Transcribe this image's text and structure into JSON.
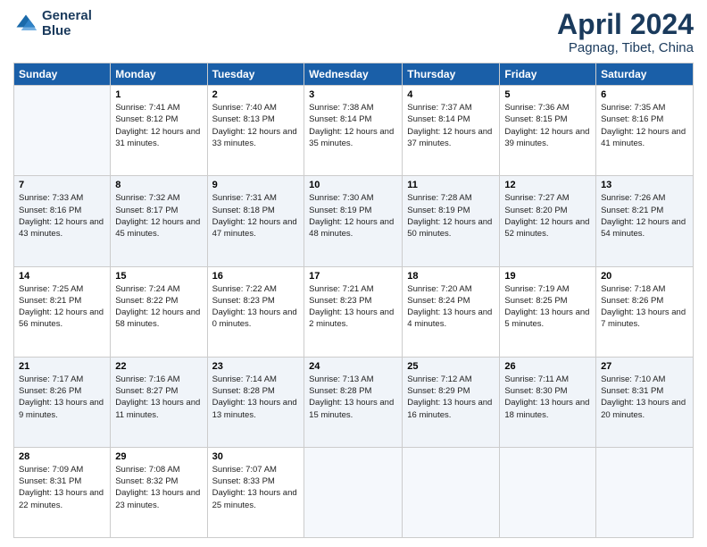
{
  "header": {
    "logo_line1": "General",
    "logo_line2": "Blue",
    "month": "April 2024",
    "location": "Pagnag, Tibet, China"
  },
  "days_of_week": [
    "Sunday",
    "Monday",
    "Tuesday",
    "Wednesday",
    "Thursday",
    "Friday",
    "Saturday"
  ],
  "weeks": [
    [
      {
        "day": "",
        "sunrise": "",
        "sunset": "",
        "daylight": ""
      },
      {
        "day": "1",
        "sunrise": "Sunrise: 7:41 AM",
        "sunset": "Sunset: 8:12 PM",
        "daylight": "Daylight: 12 hours and 31 minutes."
      },
      {
        "day": "2",
        "sunrise": "Sunrise: 7:40 AM",
        "sunset": "Sunset: 8:13 PM",
        "daylight": "Daylight: 12 hours and 33 minutes."
      },
      {
        "day": "3",
        "sunrise": "Sunrise: 7:38 AM",
        "sunset": "Sunset: 8:14 PM",
        "daylight": "Daylight: 12 hours and 35 minutes."
      },
      {
        "day": "4",
        "sunrise": "Sunrise: 7:37 AM",
        "sunset": "Sunset: 8:14 PM",
        "daylight": "Daylight: 12 hours and 37 minutes."
      },
      {
        "day": "5",
        "sunrise": "Sunrise: 7:36 AM",
        "sunset": "Sunset: 8:15 PM",
        "daylight": "Daylight: 12 hours and 39 minutes."
      },
      {
        "day": "6",
        "sunrise": "Sunrise: 7:35 AM",
        "sunset": "Sunset: 8:16 PM",
        "daylight": "Daylight: 12 hours and 41 minutes."
      }
    ],
    [
      {
        "day": "7",
        "sunrise": "Sunrise: 7:33 AM",
        "sunset": "Sunset: 8:16 PM",
        "daylight": "Daylight: 12 hours and 43 minutes."
      },
      {
        "day": "8",
        "sunrise": "Sunrise: 7:32 AM",
        "sunset": "Sunset: 8:17 PM",
        "daylight": "Daylight: 12 hours and 45 minutes."
      },
      {
        "day": "9",
        "sunrise": "Sunrise: 7:31 AM",
        "sunset": "Sunset: 8:18 PM",
        "daylight": "Daylight: 12 hours and 47 minutes."
      },
      {
        "day": "10",
        "sunrise": "Sunrise: 7:30 AM",
        "sunset": "Sunset: 8:19 PM",
        "daylight": "Daylight: 12 hours and 48 minutes."
      },
      {
        "day": "11",
        "sunrise": "Sunrise: 7:28 AM",
        "sunset": "Sunset: 8:19 PM",
        "daylight": "Daylight: 12 hours and 50 minutes."
      },
      {
        "day": "12",
        "sunrise": "Sunrise: 7:27 AM",
        "sunset": "Sunset: 8:20 PM",
        "daylight": "Daylight: 12 hours and 52 minutes."
      },
      {
        "day": "13",
        "sunrise": "Sunrise: 7:26 AM",
        "sunset": "Sunset: 8:21 PM",
        "daylight": "Daylight: 12 hours and 54 minutes."
      }
    ],
    [
      {
        "day": "14",
        "sunrise": "Sunrise: 7:25 AM",
        "sunset": "Sunset: 8:21 PM",
        "daylight": "Daylight: 12 hours and 56 minutes."
      },
      {
        "day": "15",
        "sunrise": "Sunrise: 7:24 AM",
        "sunset": "Sunset: 8:22 PM",
        "daylight": "Daylight: 12 hours and 58 minutes."
      },
      {
        "day": "16",
        "sunrise": "Sunrise: 7:22 AM",
        "sunset": "Sunset: 8:23 PM",
        "daylight": "Daylight: 13 hours and 0 minutes."
      },
      {
        "day": "17",
        "sunrise": "Sunrise: 7:21 AM",
        "sunset": "Sunset: 8:23 PM",
        "daylight": "Daylight: 13 hours and 2 minutes."
      },
      {
        "day": "18",
        "sunrise": "Sunrise: 7:20 AM",
        "sunset": "Sunset: 8:24 PM",
        "daylight": "Daylight: 13 hours and 4 minutes."
      },
      {
        "day": "19",
        "sunrise": "Sunrise: 7:19 AM",
        "sunset": "Sunset: 8:25 PM",
        "daylight": "Daylight: 13 hours and 5 minutes."
      },
      {
        "day": "20",
        "sunrise": "Sunrise: 7:18 AM",
        "sunset": "Sunset: 8:26 PM",
        "daylight": "Daylight: 13 hours and 7 minutes."
      }
    ],
    [
      {
        "day": "21",
        "sunrise": "Sunrise: 7:17 AM",
        "sunset": "Sunset: 8:26 PM",
        "daylight": "Daylight: 13 hours and 9 minutes."
      },
      {
        "day": "22",
        "sunrise": "Sunrise: 7:16 AM",
        "sunset": "Sunset: 8:27 PM",
        "daylight": "Daylight: 13 hours and 11 minutes."
      },
      {
        "day": "23",
        "sunrise": "Sunrise: 7:14 AM",
        "sunset": "Sunset: 8:28 PM",
        "daylight": "Daylight: 13 hours and 13 minutes."
      },
      {
        "day": "24",
        "sunrise": "Sunrise: 7:13 AM",
        "sunset": "Sunset: 8:28 PM",
        "daylight": "Daylight: 13 hours and 15 minutes."
      },
      {
        "day": "25",
        "sunrise": "Sunrise: 7:12 AM",
        "sunset": "Sunset: 8:29 PM",
        "daylight": "Daylight: 13 hours and 16 minutes."
      },
      {
        "day": "26",
        "sunrise": "Sunrise: 7:11 AM",
        "sunset": "Sunset: 8:30 PM",
        "daylight": "Daylight: 13 hours and 18 minutes."
      },
      {
        "day": "27",
        "sunrise": "Sunrise: 7:10 AM",
        "sunset": "Sunset: 8:31 PM",
        "daylight": "Daylight: 13 hours and 20 minutes."
      }
    ],
    [
      {
        "day": "28",
        "sunrise": "Sunrise: 7:09 AM",
        "sunset": "Sunset: 8:31 PM",
        "daylight": "Daylight: 13 hours and 22 minutes."
      },
      {
        "day": "29",
        "sunrise": "Sunrise: 7:08 AM",
        "sunset": "Sunset: 8:32 PM",
        "daylight": "Daylight: 13 hours and 23 minutes."
      },
      {
        "day": "30",
        "sunrise": "Sunrise: 7:07 AM",
        "sunset": "Sunset: 8:33 PM",
        "daylight": "Daylight: 13 hours and 25 minutes."
      },
      {
        "day": "",
        "sunrise": "",
        "sunset": "",
        "daylight": ""
      },
      {
        "day": "",
        "sunrise": "",
        "sunset": "",
        "daylight": ""
      },
      {
        "day": "",
        "sunrise": "",
        "sunset": "",
        "daylight": ""
      },
      {
        "day": "",
        "sunrise": "",
        "sunset": "",
        "daylight": ""
      }
    ]
  ]
}
